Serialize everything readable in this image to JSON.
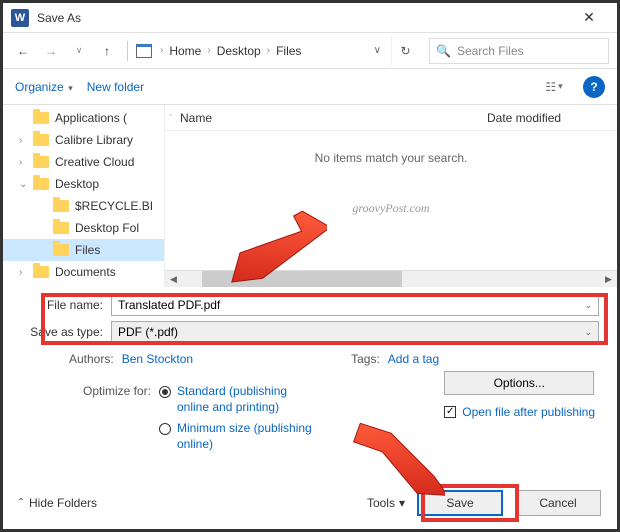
{
  "title": "Save As",
  "breadcrumb": {
    "home": "Home",
    "desktop": "Desktop",
    "files": "Files"
  },
  "search": {
    "placeholder": "Search Files"
  },
  "toolbar": {
    "organize": "Organize",
    "new_folder": "New folder"
  },
  "tree": {
    "applications": "Applications (",
    "calibre": "Calibre Library",
    "creative": "Creative Cloud",
    "desktop": "Desktop",
    "recycle": "$RECYCLE.BI",
    "desktop_fol": "Desktop Fol",
    "files": "Files",
    "documents": "Documents"
  },
  "columns": {
    "name": "Name",
    "date": "Date modified"
  },
  "empty_msg": "No items match your search.",
  "watermark": "groovyPost.com",
  "fields": {
    "filename_label": "File name:",
    "filename_value": "Translated PDF.pdf",
    "type_label": "Save as type:",
    "type_value": "PDF (*.pdf)"
  },
  "meta": {
    "authors_label": "Authors:",
    "authors_value": "Ben Stockton",
    "tags_label": "Tags:",
    "tags_value": "Add a tag"
  },
  "optimize": {
    "label": "Optimize for:",
    "standard": "Standard (publishing online and printing)",
    "minimum": "Minimum size (publishing online)"
  },
  "options": {
    "button": "Options...",
    "open_after": "Open file after publishing"
  },
  "footer": {
    "hide": "Hide Folders",
    "tools": "Tools",
    "save": "Save",
    "cancel": "Cancel"
  }
}
